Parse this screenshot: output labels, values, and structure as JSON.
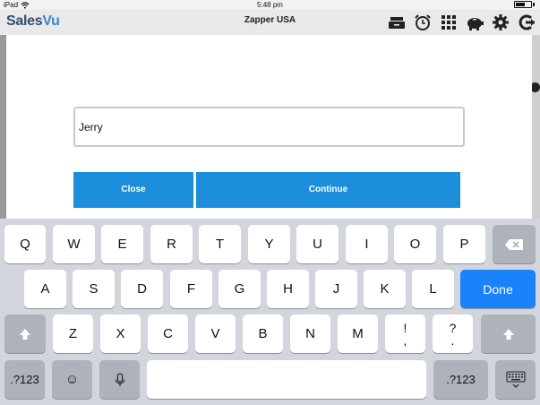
{
  "status_bar": {
    "device": "iPad",
    "time": "5:48 pm"
  },
  "app": {
    "logo_part1": "Sales",
    "logo_part2": "Vu",
    "title": "Zapper USA"
  },
  "toolbar": {
    "icons": [
      "cash-drawer-icon",
      "alarm-clock-icon",
      "grid-icon",
      "piggy-bank-icon",
      "gear-icon",
      "logout-icon"
    ]
  },
  "dialog": {
    "input_value": "Jerry",
    "close_label": "Close",
    "continue_label": "Continue"
  },
  "keyboard": {
    "row1": [
      "Q",
      "W",
      "E",
      "R",
      "T",
      "Y",
      "U",
      "I",
      "O",
      "P"
    ],
    "row2": [
      "A",
      "S",
      "D",
      "F",
      "G",
      "H",
      "J",
      "K",
      "L"
    ],
    "row3": [
      "Z",
      "X",
      "C",
      "V",
      "B",
      "N",
      "M"
    ],
    "done_label": "Done",
    "exclaim_top": "!",
    "exclaim_bottom": ",",
    "question_top": "?",
    "question_bottom": ".",
    "num_left": ".?123",
    "num_right": ".?123",
    "emoji_glyph": "☺"
  },
  "colors": {
    "accent": "#1d8edb",
    "done_key": "#1a82fb",
    "logo_dark": "#2f4f72",
    "logo_light": "#3e86c8"
  }
}
